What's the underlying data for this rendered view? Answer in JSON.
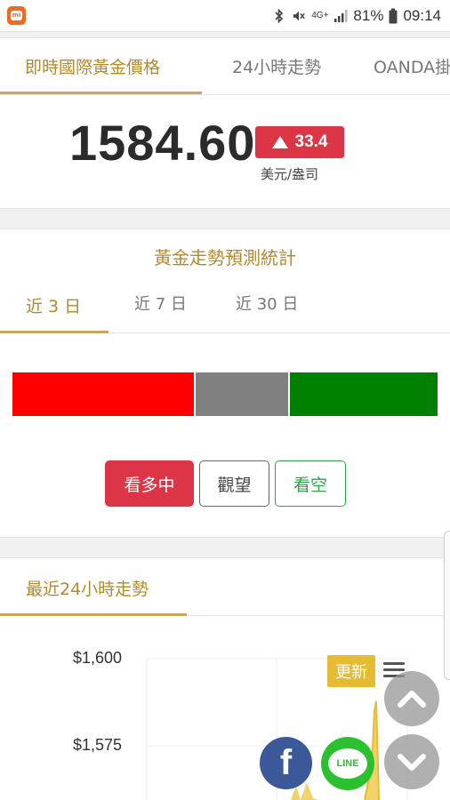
{
  "status_bar": {
    "battery": "81%",
    "time": "09:14",
    "network": "4G+",
    "app_icon": "mi-icon"
  },
  "top_tabs": [
    {
      "label": "即時國際黃金價格",
      "active": true
    },
    {
      "label": "24小時走勢",
      "active": false
    },
    {
      "label": "OANDA掛",
      "active": false
    }
  ],
  "price": {
    "value": "1584.60",
    "change": "33.4",
    "direction": "up",
    "unit": "美元/盎司"
  },
  "forecast": {
    "title": "黃金走勢預測統計",
    "tabs": [
      {
        "label": "近 3 日",
        "active": true
      },
      {
        "label": "近 7 日",
        "active": false
      },
      {
        "label": "近 30 日",
        "active": false
      }
    ],
    "distribution": [
      {
        "label": "看多",
        "share": 0.43,
        "color": "#ff0000"
      },
      {
        "label": "觀望",
        "share": 0.22,
        "color": "#808080"
      },
      {
        "label": "看空",
        "share": 0.35,
        "color": "#008000"
      }
    ],
    "buttons": {
      "bullish": "看多中",
      "hold": "觀望",
      "bearish": "看空"
    }
  },
  "chart": {
    "title": "最近24小時走勢",
    "update_label": "更新",
    "y_ticks": [
      "$1,600",
      "$1,575"
    ]
  },
  "colors": {
    "accent_gold": "#b08a2e",
    "up_red": "#dc3545",
    "bear_green": "#28a745",
    "update_yellow": "#e6bb31"
  },
  "floating": {
    "facebook_label": "f",
    "line_label": "LINE"
  }
}
